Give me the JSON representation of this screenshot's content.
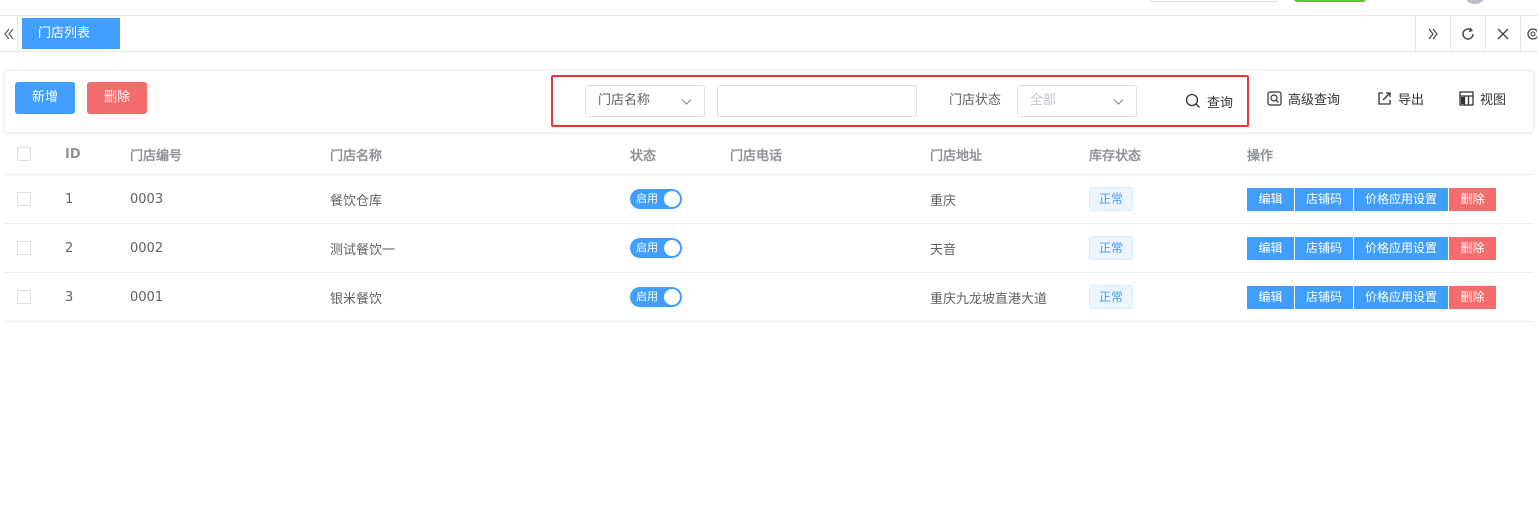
{
  "tabs": [
    {
      "label": "门店列表",
      "active": true
    }
  ],
  "toolbar": {
    "add_label": "新增",
    "delete_label": "删除"
  },
  "search": {
    "field_selected": "门店名称",
    "keyword_value": "",
    "status_label": "门店状态",
    "status_selected": "全部",
    "query_label": "查询"
  },
  "tools": {
    "advanced": "高级查询",
    "export": "导出",
    "view": "视图"
  },
  "table": {
    "headers": {
      "id": "ID",
      "code": "门店编号",
      "name": "门店名称",
      "status": "状态",
      "phone": "门店电话",
      "address": "门店地址",
      "stock": "库存状态",
      "ops": "操作"
    },
    "rows": [
      {
        "id": "1",
        "code": "0003",
        "name": "餐饮仓库",
        "switch_label": "启用",
        "phone": "",
        "address": "重庆",
        "stock": "正常"
      },
      {
        "id": "2",
        "code": "0002",
        "name": "测试餐饮一",
        "switch_label": "启用",
        "phone": "",
        "address": "天音",
        "stock": "正常"
      },
      {
        "id": "3",
        "code": "0001",
        "name": "银米餐饮",
        "switch_label": "启用",
        "phone": "",
        "address": "重庆九龙坡直港大道",
        "stock": "正常"
      }
    ],
    "row_actions": {
      "edit": "编辑",
      "store_code": "店铺码",
      "price_setting": "价格应用设置",
      "delete": "删除"
    }
  },
  "colors": {
    "primary": "#409eff",
    "danger": "#f56c6c",
    "success": "#67c23a",
    "highlight_border": "#e53935"
  }
}
